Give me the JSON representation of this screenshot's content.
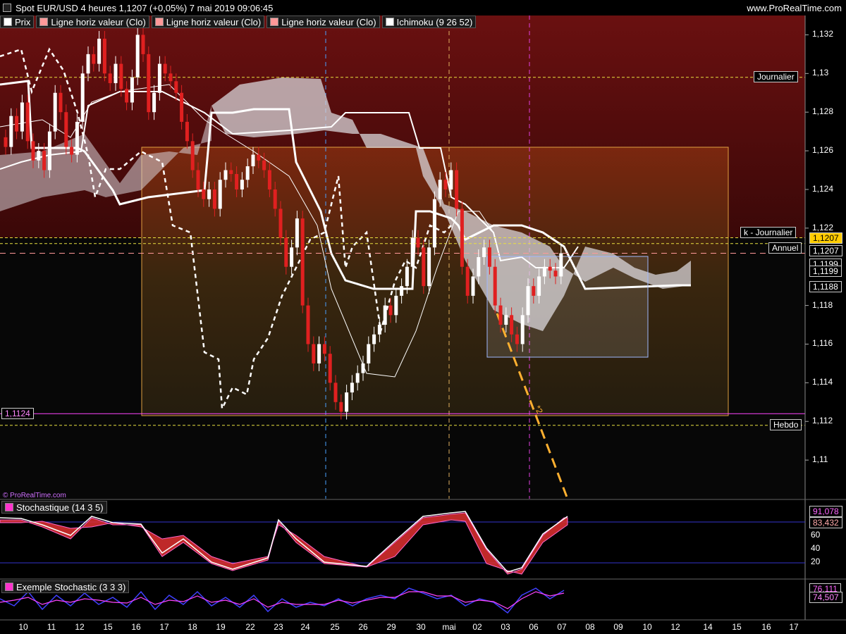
{
  "header": {
    "title": "Spot EUR/USD 4 heures 1,1207 (+0,05%) 7 mai 2019 09:06:45",
    "site": "www.ProRealTime.com",
    "credit": "© ProRealTime.com"
  },
  "legend": [
    {
      "label": "Prix",
      "color": "#ffffff"
    },
    {
      "label": "Ligne horiz valeur (Clo)",
      "color": "#ff9999"
    },
    {
      "label": "Ligne horiz valeur (Clo)",
      "color": "#ff9999"
    },
    {
      "label": "Ligne horiz valeur (Clo)",
      "color": "#ff9999"
    },
    {
      "label": "Ichimoku (9 26 52)",
      "color": "#ffffff"
    }
  ],
  "colors": {
    "bull": "#ffffff",
    "bear": "#e02020",
    "upper_zone": "#5a0d0d",
    "lower_zone": "#3a2a10",
    "projection": "#ffb030",
    "stoch_line": "#3333cc",
    "accent_pink": "#ff33cc"
  },
  "price_axis": {
    "ticks": [
      "1,132",
      "1,13",
      "1,128",
      "1,126",
      "1,124",
      "1,122",
      "1,118",
      "1,116",
      "1,114",
      "1,112",
      "1,11"
    ],
    "ymin": 1.108,
    "ymax": 1.133
  },
  "levels": [
    {
      "label": "Journalier",
      "value": 1.1298
    },
    {
      "label": "k - Journalier",
      "value": 1.1215
    },
    {
      "label": "Annuel",
      "value": 1.1212
    },
    {
      "label": "Hebdo",
      "value": 1.1118
    },
    {
      "label": "1,1124",
      "value": 1.1124
    }
  ],
  "price_tags": [
    "1,1207",
    "1,1207",
    "1,1199",
    "1,1199",
    "1,1188"
  ],
  "annotation": "*2",
  "x_axis": {
    "labels": [
      "10",
      "11",
      "12",
      "15",
      "16",
      "17",
      "18",
      "19",
      "22",
      "23",
      "24",
      "25",
      "26",
      "29",
      "30",
      "mai",
      "02",
      "03",
      "06",
      "07",
      "08",
      "09",
      "10",
      "12",
      "14",
      "15",
      "16",
      "17"
    ]
  },
  "stochastic": {
    "title": "Stochastique (14 3 5)",
    "values": [
      "91,078",
      "83,432"
    ],
    "ticks": [
      "60",
      "40",
      "20"
    ]
  },
  "example_stochastic": {
    "title": "Exemple Stochastic (3 3 3)",
    "values": [
      "76,111",
      "74,507"
    ]
  },
  "chart_data": {
    "type": "candlestick",
    "title": "Spot EUR/USD 4 heures",
    "ylim": [
      1.108,
      1.133
    ],
    "closes": [
      1.1262,
      1.1278,
      1.127,
      1.1285,
      1.1265,
      1.1255,
      1.126,
      1.125,
      1.127,
      1.129,
      1.128,
      1.1262,
      1.1258,
      1.1275,
      1.13,
      1.131,
      1.1305,
      1.1318,
      1.13,
      1.1295,
      1.1305,
      1.1292,
      1.1285,
      1.1298,
      1.132,
      1.131,
      1.128,
      1.129,
      1.1305,
      1.13,
      1.1296,
      1.129,
      1.1275,
      1.1265,
      1.125,
      1.124,
      1.1235,
      1.124,
      1.123,
      1.1245,
      1.125,
      1.1248,
      1.124,
      1.1245,
      1.1252,
      1.1258,
      1.1255,
      1.125,
      1.124,
      1.123,
      1.1215,
      1.12,
      1.121,
      1.1225,
      1.118,
      1.116,
      1.115,
      1.116,
      1.1155,
      1.114,
      1.113,
      1.1125,
      1.1135,
      1.114,
      1.1145,
      1.115,
      1.116,
      1.1165,
      1.117,
      1.118,
      1.1175,
      1.1185,
      1.119,
      1.12,
      1.1215,
      1.121,
      1.119,
      1.121,
      1.1235,
      1.1245,
      1.124,
      1.125,
      1.123,
      1.12,
      1.1185,
      1.1195,
      1.1205,
      1.121,
      1.12,
      1.118,
      1.117,
      1.1175,
      1.1165,
      1.116,
      1.1175,
      1.119,
      1.1185,
      1.1195,
      1.12,
      1.1198,
      1.1195,
      1.1207
    ]
  }
}
